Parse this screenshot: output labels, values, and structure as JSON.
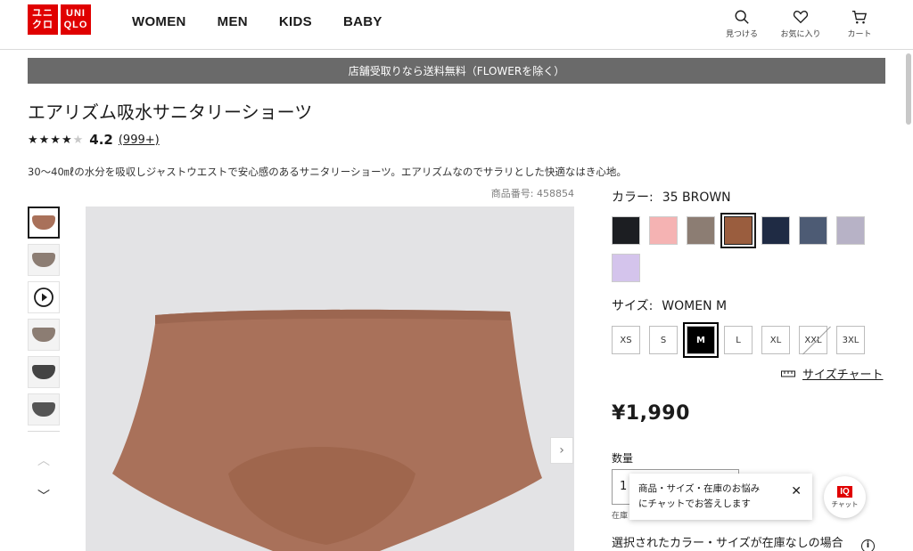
{
  "header": {
    "logo_top": "ユニ",
    "logo_bottom": "クロ",
    "logo_top_en": "UNI",
    "logo_bottom_en": "QLO",
    "nav": [
      "WOMEN",
      "MEN",
      "KIDS",
      "BABY"
    ],
    "icons": [
      {
        "icon": "search-icon",
        "label": "見つける"
      },
      {
        "icon": "heart-icon",
        "label": "お気に入り"
      },
      {
        "icon": "cart-icon",
        "label": "カート"
      }
    ]
  },
  "banner": "店舗受取りなら送料無料（FLOWERを除く）",
  "product": {
    "title": "エアリズム吸水サニタリーショーツ",
    "rating_value": "4.2",
    "rating_count": "(999+)",
    "stars": 4,
    "description": "30〜40㎖の水分を吸収しジャストウエストで安心感のあるサニタリーショーツ。エアリズムなのでサラリとした快適なはき心地。",
    "product_number": "商品番号: 458854",
    "color_label": "カラー:",
    "color_value": "35 BROWN",
    "colors": [
      "#1c1e22",
      "#f5b3b3",
      "#8c7d73",
      "#9a5d3e",
      "#1f2b44",
      "#4d5b74",
      "#b7b2c6",
      "#d4c4ec"
    ],
    "selected_color_index": 3,
    "size_label": "サイズ:",
    "size_value": "WOMEN M",
    "sizes": [
      "XS",
      "S",
      "M",
      "L",
      "XL",
      "XXL",
      "3XL"
    ],
    "selected_size": "M",
    "unavailable_size": "XXL",
    "size_chart": "サイズチャート",
    "price": "¥1,990",
    "quantity_label": "数量",
    "quantity_value": "1",
    "stock_label": "在庫",
    "oos_note": "選択されたカラー・サイズが在庫なしの場合",
    "image_color": "#a9715a"
  },
  "thumbnails": [
    {
      "color": "#a9715a",
      "type": "image"
    },
    {
      "color": "#8c7d73",
      "type": "image"
    },
    {
      "color": "",
      "type": "video"
    },
    {
      "color": "#8c7d73",
      "type": "image"
    },
    {
      "color": "#444",
      "type": "image"
    },
    {
      "color": "#555",
      "type": "image"
    }
  ],
  "chat": {
    "popup_line1": "商品・サイズ・在庫のお悩み",
    "popup_line2": "にチャットでお答えします",
    "close": "✕",
    "button_logo": "IQ",
    "button_label": "チャット"
  }
}
